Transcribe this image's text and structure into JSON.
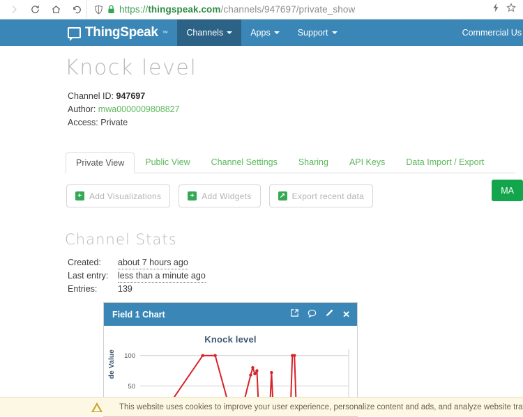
{
  "browser": {
    "icons": {
      "forward": "forward-chevron-icon",
      "reload": "reload-icon",
      "home": "home-icon",
      "back": "back-arrow-icon",
      "shield": "tracking-shield-icon",
      "lock": "padlock-icon",
      "reader": "lightning-bolt-icon",
      "bookmark": "star-icon"
    },
    "url": {
      "scheme": "https://",
      "host": "thingspeak.com",
      "path": "/channels/947697/private_show"
    }
  },
  "navbar": {
    "brand": "ThingSpeak",
    "brand_tm": "™",
    "items": [
      {
        "label": "Channels",
        "active": true,
        "caret": true
      },
      {
        "label": "Apps",
        "active": false,
        "caret": true
      },
      {
        "label": "Support",
        "active": false,
        "caret": true
      }
    ],
    "right_label": "Commercial Us"
  },
  "channel": {
    "title": "Knock level",
    "id_label": "Channel ID:",
    "id_value": "947697",
    "author_label": "Author:",
    "author_value": "mwa0000009808827",
    "access_label": "Access:",
    "access_value": "Private"
  },
  "tabs": [
    {
      "label": "Private View",
      "active": true
    },
    {
      "label": "Public View",
      "active": false
    },
    {
      "label": "Channel Settings",
      "active": false
    },
    {
      "label": "Sharing",
      "active": false
    },
    {
      "label": "API Keys",
      "active": false
    },
    {
      "label": "Data Import / Export",
      "active": false
    }
  ],
  "actions": {
    "add_visualizations": "Add Visualizations",
    "add_widgets": "Add Widgets",
    "export_recent": "Export recent data",
    "plus_glyph": "+",
    "export_glyph": "↗",
    "matlab_button": "MA"
  },
  "stats": {
    "heading": "Channel Stats",
    "created_label": "Created:",
    "created_value": "about 7 hours ago",
    "last_entry_label": "Last entry:",
    "last_entry_value": "less than a minute ago",
    "entries_label": "Entries:",
    "entries_value": "139"
  },
  "chart_panel": {
    "header": "Field 1 Chart",
    "icons": [
      "external-link-icon",
      "comment-icon",
      "pencil-icon",
      "close-icon"
    ],
    "close_glyph": "✕",
    "comment_glyph": "◯"
  },
  "cookie": {
    "text": "This website uses cookies to improve your user experience, personalize content and ads, and analyze website traffic. By continuing to use"
  },
  "chart_data": {
    "type": "line",
    "title": "Knock level",
    "xlabel": "",
    "ylabel": "de Value",
    "ylabel_full": "Node Value",
    "ylim": [
      0,
      110
    ],
    "yticks": [
      50,
      100
    ],
    "ytick_labels": [
      "50",
      "100"
    ],
    "grid": true,
    "line_color": "#d6232a",
    "title_color": "#3e5871",
    "series": [
      {
        "name": "Field 1",
        "x": [
          0,
          5,
          10,
          30,
          36,
          44,
          45,
          46,
          47,
          48,
          53,
          54,
          55,
          56,
          57,
          62,
          63,
          64,
          72,
          73,
          74,
          75,
          100
        ],
        "y": [
          0,
          0,
          0,
          100,
          100,
          0,
          0,
          0,
          0,
          0,
          68,
          80,
          70,
          75,
          0,
          0,
          72,
          0,
          0,
          100,
          100,
          0,
          0
        ]
      }
    ]
  }
}
